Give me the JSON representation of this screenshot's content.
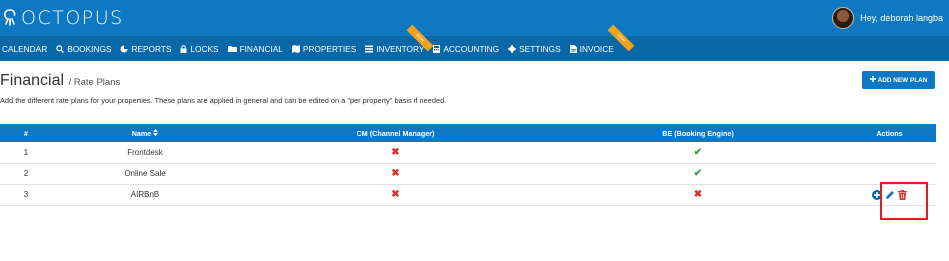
{
  "app": {
    "logo_text": "OCTOPUS",
    "greeting": "Hey, deborah langba"
  },
  "nav": {
    "items": [
      {
        "label": "CALENDAR",
        "icon": ""
      },
      {
        "label": "BOOKINGS",
        "icon": "search-icon"
      },
      {
        "label": "REPORTS",
        "icon": "pie-chart-icon"
      },
      {
        "label": "LOCKS",
        "icon": "lock-icon"
      },
      {
        "label": "FINANCIAL",
        "icon": "folder-icon"
      },
      {
        "label": "PROPERTIES",
        "icon": "map-icon"
      },
      {
        "label": "INVENTORY",
        "icon": "list-icon",
        "ribbon": "NEW"
      },
      {
        "label": "ACCOUNTING",
        "icon": "calculator-icon"
      },
      {
        "label": "SETTINGS",
        "icon": "gear-icon"
      },
      {
        "label": "INVOICE",
        "icon": "file-icon",
        "ribbon": "NEW"
      }
    ]
  },
  "page": {
    "title": "Financial",
    "subtitle": "/ Rate Plans",
    "description": "Add the different rate plans for your properties. These plans are applied in general and can be edited on a \"per property\" basis if needed.",
    "add_button": "ADD NEW PLAN"
  },
  "table": {
    "headers": {
      "num": "#",
      "name": "Name",
      "cm": "CM (Channel Manager)",
      "be": "BE (Booking Engine)",
      "actions": "Actions"
    },
    "rows": [
      {
        "num": "1",
        "name": "Frontdesk",
        "cm": false,
        "be": true,
        "has_actions": false
      },
      {
        "num": "2",
        "name": "Online Sale",
        "cm": false,
        "be": true,
        "has_actions": false
      },
      {
        "num": "3",
        "name": "AIRBnB",
        "cm": false,
        "be": false,
        "has_actions": true
      }
    ]
  },
  "colors": {
    "primary": "#0e79c2",
    "nav": "#0a68a8",
    "ribbon": "#f0a21b",
    "cross": "#d9342b",
    "check": "#2aa64a",
    "highlight": "#e02020"
  }
}
